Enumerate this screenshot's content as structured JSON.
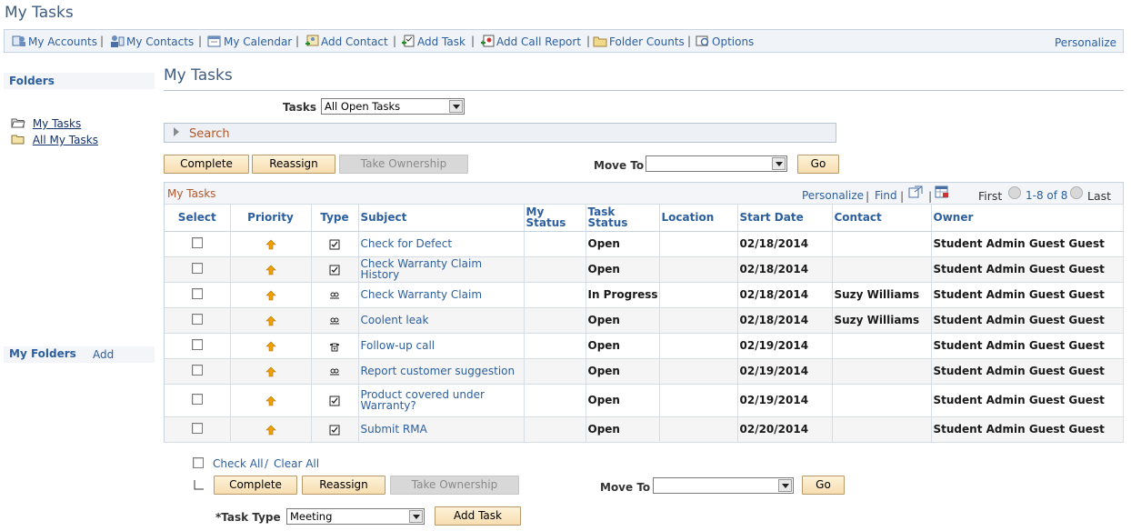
{
  "page": {
    "title": "My Tasks"
  },
  "toolbar": {
    "items": [
      {
        "label": "My Accounts",
        "icon": "accounts-icon"
      },
      {
        "label": "My Contacts",
        "icon": "contacts-icon"
      },
      {
        "label": "My Calendar",
        "icon": "calendar-icon"
      },
      {
        "label": "Add Contact",
        "icon": "add-contact-icon"
      },
      {
        "label": "Add Task",
        "icon": "add-task-icon"
      },
      {
        "label": "Add Call Report",
        "icon": "call-report-icon"
      },
      {
        "label": "Folder Counts",
        "icon": "folder-counts-icon"
      },
      {
        "label": "Options",
        "icon": "options-icon"
      }
    ],
    "separator": "|",
    "personalize": "Personalize"
  },
  "sidebar": {
    "folders_heading": "Folders",
    "folders": [
      {
        "label": "My Tasks",
        "icon": "open-folder-icon"
      },
      {
        "label": "All My Tasks",
        "icon": "folder-icon"
      }
    ],
    "my_folders_heading": "My Folders",
    "add_label": "Add"
  },
  "main": {
    "title": "My Tasks",
    "tasks_label": "Tasks",
    "tasks_filter_value": "All Open Tasks",
    "search_label": "Search",
    "buttons": {
      "complete": "Complete",
      "reassign": "Reassign",
      "take_ownership": "Take Ownership",
      "go": "Go"
    },
    "move_to_label": "Move To",
    "move_to_value": ""
  },
  "grid": {
    "caption": "My Tasks",
    "personalize": "Personalize",
    "find": "Find",
    "nav_sep": "|",
    "first": "First",
    "range": "1-8 of 8",
    "last": "Last",
    "columns": [
      "Select",
      "Priority",
      "Type",
      "Subject",
      "My Status",
      "Task Status",
      "Location",
      "Start Date",
      "Contact",
      "Owner"
    ],
    "rows": [
      {
        "checked": false,
        "priority": "high",
        "type_icon": "task-check-icon",
        "subject": "Check for Defect",
        "my_status": "",
        "task_status": "Open",
        "location": "",
        "start_date": "02/18/2014",
        "contact": "",
        "owner": "Student Admin Guest Guest"
      },
      {
        "checked": false,
        "priority": "high",
        "type_icon": "task-check-icon",
        "subject": "Check Warranty Claim History",
        "my_status": "",
        "task_status": "Open",
        "location": "",
        "start_date": "02/18/2014",
        "contact": "",
        "owner": "Student Admin Guest Guest"
      },
      {
        "checked": false,
        "priority": "high",
        "type_icon": "meeting-icon",
        "subject": "Check Warranty Claim",
        "my_status": "",
        "task_status": "In Progress",
        "location": "",
        "start_date": "02/18/2014",
        "contact": "Suzy Williams",
        "owner": "Student Admin Guest Guest"
      },
      {
        "checked": false,
        "priority": "high",
        "type_icon": "meeting-icon",
        "subject": "Coolent leak",
        "my_status": "",
        "task_status": "Open",
        "location": "",
        "start_date": "02/18/2014",
        "contact": "Suzy Williams",
        "owner": "Student Admin Guest Guest"
      },
      {
        "checked": false,
        "priority": "high",
        "type_icon": "phone-icon",
        "subject": "Follow-up call",
        "my_status": "",
        "task_status": "Open",
        "location": "",
        "start_date": "02/19/2014",
        "contact": "",
        "owner": "Student Admin Guest Guest"
      },
      {
        "checked": false,
        "priority": "high",
        "type_icon": "meeting-icon",
        "subject": "Report customer suggestion",
        "my_status": "",
        "task_status": "Open",
        "location": "",
        "start_date": "02/19/2014",
        "contact": "",
        "owner": "Student Admin Guest Guest"
      },
      {
        "checked": false,
        "priority": "high",
        "type_icon": "task-check-icon",
        "subject": "Product covered under Warranty?",
        "my_status": "",
        "task_status": "Open",
        "location": "",
        "start_date": "02/19/2014",
        "contact": "",
        "owner": "Student Admin Guest Guest"
      },
      {
        "checked": false,
        "priority": "high",
        "type_icon": "task-check-icon",
        "subject": "Submit RMA",
        "my_status": "",
        "task_status": "Open",
        "location": "",
        "start_date": "02/20/2014",
        "contact": "",
        "owner": "Student Admin Guest Guest"
      }
    ]
  },
  "footer": {
    "check_all": "Check All",
    "slash": "/",
    "clear_all": "Clear All",
    "task_type_label": "*Task Type",
    "task_type_value": "Meeting",
    "add_task": "Add Task"
  },
  "colors": {
    "link": "#2c5f9e",
    "caption": "#b2582a",
    "priority_arrow": "#f0a000",
    "button_bg": "#f7ddb0"
  }
}
